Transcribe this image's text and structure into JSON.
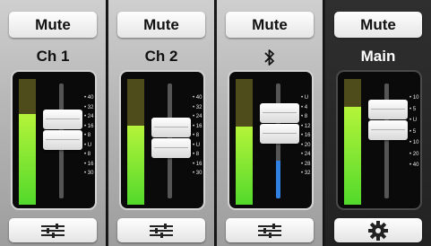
{
  "strips": [
    {
      "id": "ch1",
      "mute_label": "Mute",
      "label": "Ch 1",
      "label_type": "text",
      "bottom_icon": "sliders-icon",
      "meter_level": 0.72,
      "fader_level": 0.64,
      "show_track_fill": false,
      "scale": [
        "40",
        "32",
        "24",
        "16",
        "8",
        "U",
        "8",
        "16",
        "30"
      ]
    },
    {
      "id": "ch2",
      "mute_label": "Mute",
      "label": "Ch 2",
      "label_type": "text",
      "bottom_icon": "sliders-icon",
      "meter_level": 0.63,
      "fader_level": 0.55,
      "show_track_fill": false,
      "scale": [
        "40",
        "32",
        "24",
        "16",
        "8",
        "U",
        "8",
        "16",
        "30"
      ]
    },
    {
      "id": "bt",
      "mute_label": "Mute",
      "label": "",
      "label_type": "bluetooth-icon",
      "bottom_icon": "sliders-icon",
      "meter_level": 0.62,
      "fader_level": 0.72,
      "show_track_fill": true,
      "scale": [
        "U",
        "4",
        "8",
        "12",
        "16",
        "20",
        "24",
        "28",
        "32"
      ]
    },
    {
      "id": "main",
      "mute_label": "Mute",
      "label": "Main",
      "label_type": "text",
      "bottom_icon": "gear-icon",
      "meter_level": 0.78,
      "fader_level": 0.76,
      "show_track_fill": false,
      "dark": true,
      "scale": [
        "10",
        "5",
        "U",
        "5",
        "10",
        "20",
        "40"
      ]
    }
  ],
  "colors": {
    "meter_green": "#52d92b",
    "meter_inactive": "#4e4c1a",
    "track_blue": "#2f80e0"
  }
}
